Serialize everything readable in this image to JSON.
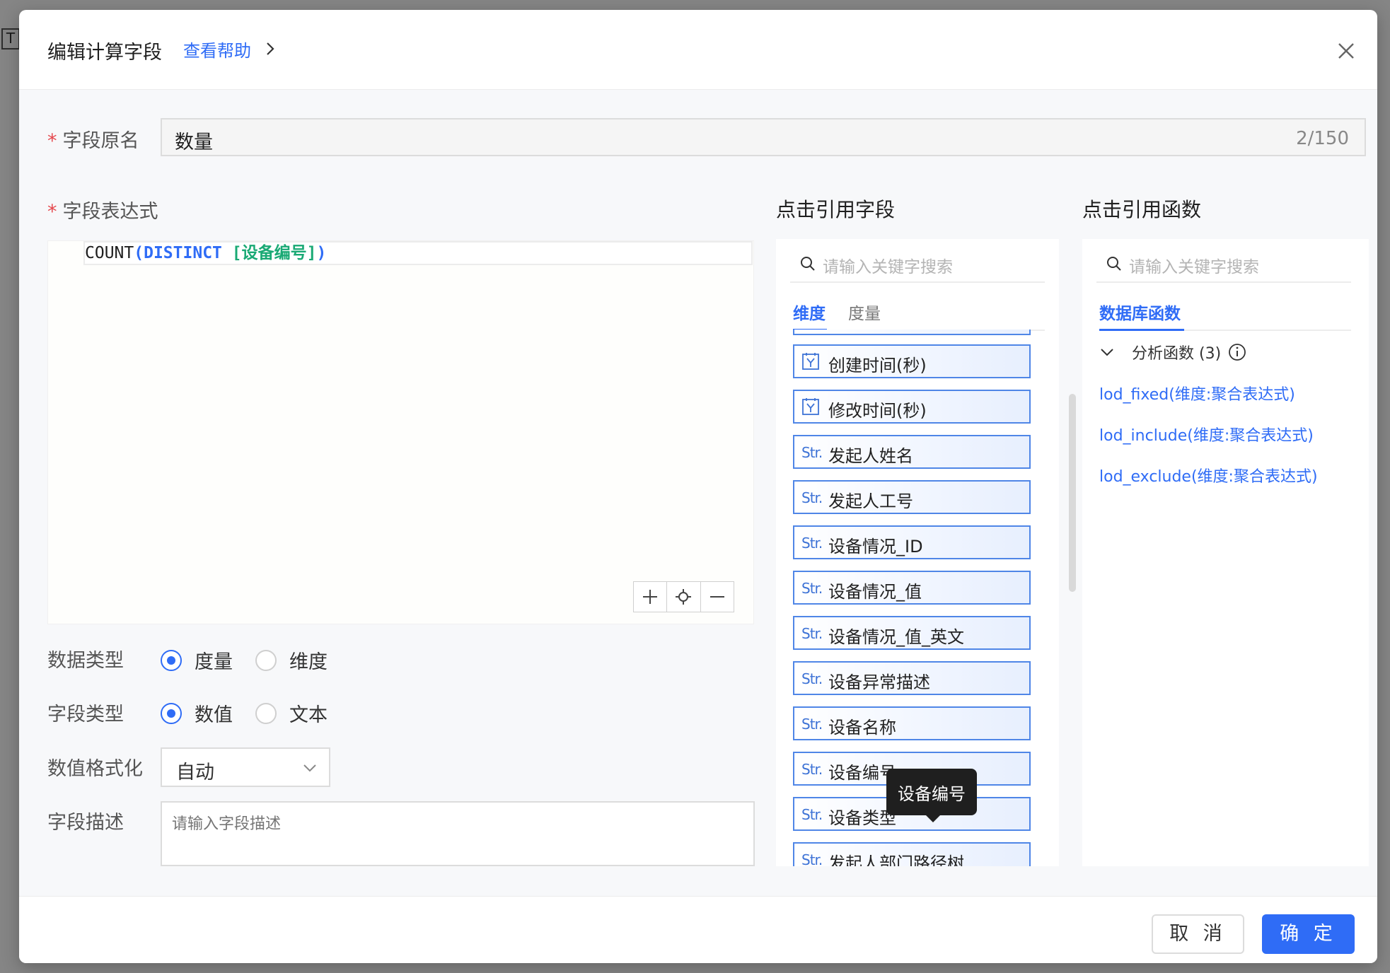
{
  "dialog": {
    "title": "编辑计算字段",
    "help_link": "查看帮助"
  },
  "form": {
    "name_label": "字段原名",
    "name_value": "数量",
    "name_count": "2/150",
    "expr_label": "字段表达式",
    "expression": {
      "fn": "COUNT",
      "open": "(",
      "keyword": "DISTINCT",
      "field": "[设备编号]",
      "close": ")"
    },
    "data_type": {
      "label": "数据类型",
      "options": [
        "度量",
        "维度"
      ],
      "selected": "度量"
    },
    "field_type": {
      "label": "字段类型",
      "options": [
        "数值",
        "文本"
      ],
      "selected": "数值"
    },
    "number_format": {
      "label": "数值格式化",
      "value": "自动"
    },
    "description": {
      "label": "字段描述",
      "placeholder": "请输入字段描述"
    }
  },
  "field_panel": {
    "title": "点击引用字段",
    "search_placeholder": "请输入关键字搜索",
    "tabs": [
      "维度",
      "度量"
    ],
    "active_tab": "维度",
    "items": [
      {
        "type": "date",
        "type_label": "",
        "name": "创建时间(秒)"
      },
      {
        "type": "date",
        "type_label": "",
        "name": "修改时间(秒)"
      },
      {
        "type": "str",
        "type_label": "Str.",
        "name": "发起人姓名"
      },
      {
        "type": "str",
        "type_label": "Str.",
        "name": "发起人工号"
      },
      {
        "type": "str",
        "type_label": "Str.",
        "name": "设备情况_ID"
      },
      {
        "type": "str",
        "type_label": "Str.",
        "name": "设备情况_值"
      },
      {
        "type": "str",
        "type_label": "Str.",
        "name": "设备情况_值_英文"
      },
      {
        "type": "str",
        "type_label": "Str.",
        "name": "设备异常描述"
      },
      {
        "type": "str",
        "type_label": "Str.",
        "name": "设备名称"
      },
      {
        "type": "str",
        "type_label": "Str.",
        "name": "设备编号"
      },
      {
        "type": "str",
        "type_label": "Str.",
        "name": "设备类型"
      },
      {
        "type": "str",
        "type_label": "Str.",
        "name": "发起人部门路径树"
      }
    ],
    "tooltip": "设备编号"
  },
  "function_panel": {
    "title": "点击引用函数",
    "search_placeholder": "请输入关键字搜索",
    "tab": "数据库函数",
    "group": "分析函数 (3)",
    "functions": [
      "lod_fixed(维度:聚合表达式)",
      "lod_include(维度:聚合表达式)",
      "lod_exclude(维度:聚合表达式)"
    ]
  },
  "footer": {
    "cancel": "取 消",
    "ok": "确 定"
  },
  "colors": {
    "accent": "#2f6cf6",
    "required": "#e5484d",
    "field_green": "#19a974"
  }
}
